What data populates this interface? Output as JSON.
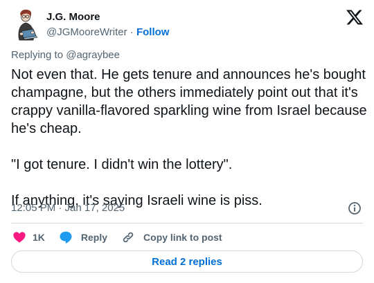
{
  "author": {
    "name": "J.G. Moore",
    "handle": "@JGMooreWriter",
    "separator": " · ",
    "follow_label": "Follow"
  },
  "replying_to": "Replying to @agraybee",
  "tweet_text": "Not even that. He gets tenure and announces he's bought champagne, but the others immediately point out that it's crappy vanilla-flavored sparkling wine from Israel because he's cheap.\n\n\"I got tenure. I didn't win the lottery\".\n\nIf anything, it's saying Israeli wine is piss.",
  "timestamp": "12:05 PM · Jan 17, 2025",
  "actions": {
    "like_count": "1K",
    "reply_label": "Reply",
    "copy_label": "Copy link to post"
  },
  "read_replies_label": "Read 2 replies",
  "icons": {
    "logo": "x-logo-icon",
    "info": "info-icon",
    "like": "heart-icon",
    "reply": "speech-bubble-icon",
    "copy": "link-icon"
  },
  "colors": {
    "like": "#f91880",
    "reply": "#1d9bf0",
    "link": "#006fd6",
    "muted": "#536471",
    "text": "#0f1419",
    "border": "#cfd9de"
  }
}
